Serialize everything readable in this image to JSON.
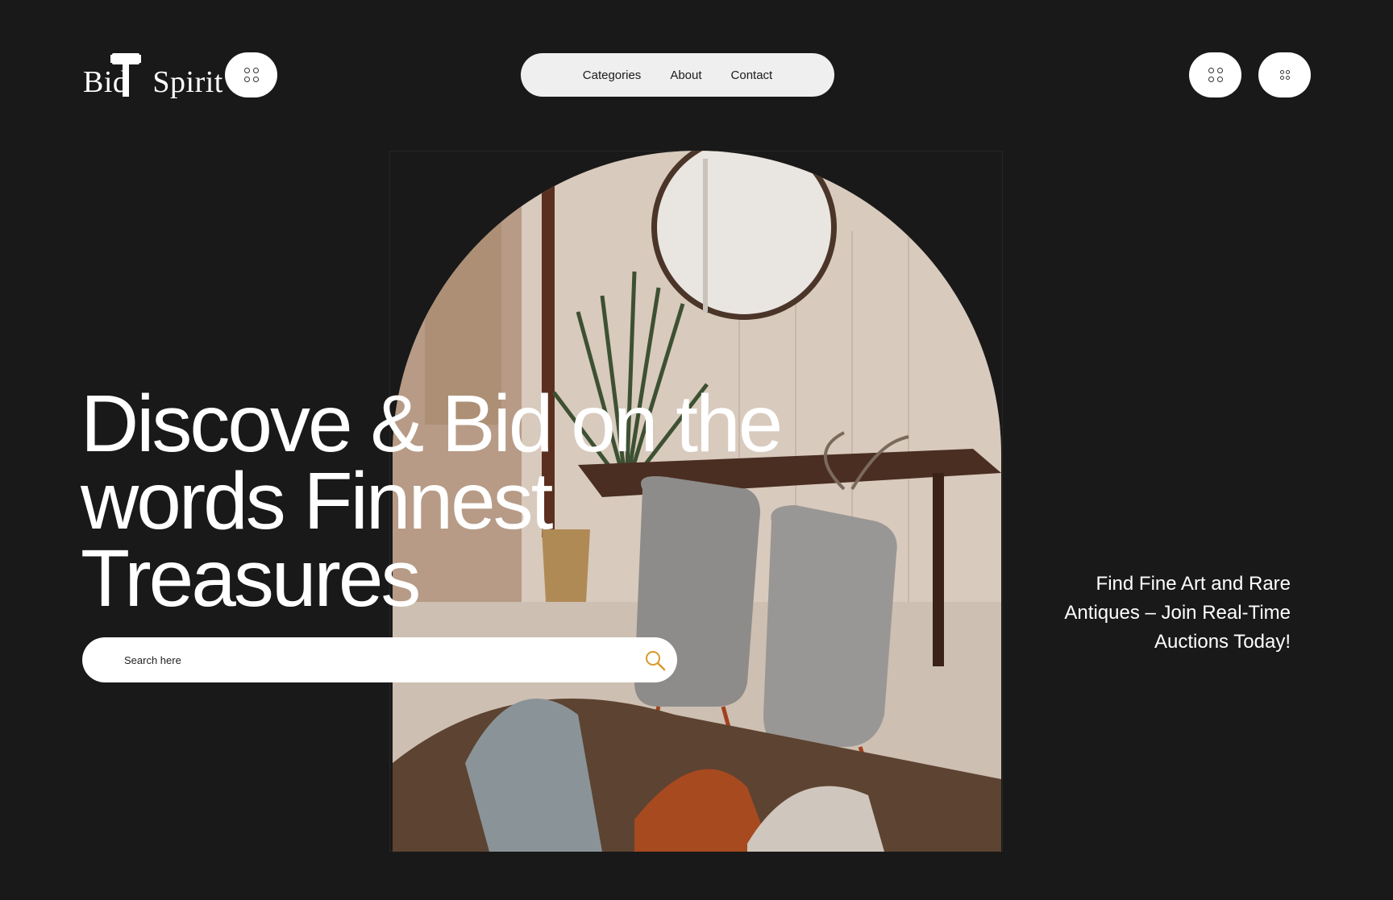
{
  "brand": {
    "logo_word_1": "Bid",
    "logo_word_2": "Spirit"
  },
  "header": {
    "nav": [
      {
        "label": "Categories"
      },
      {
        "label": "About"
      },
      {
        "label": "Contact"
      }
    ],
    "icons": {
      "menu": "grid-dots-icon",
      "apps": "grid-dots-icon",
      "more": "grid-dots-small-icon"
    }
  },
  "hero": {
    "headline_line_1": "Discove & Bid on the",
    "headline_line_2": "words Finnest",
    "headline_line_3": "Treasures",
    "search_placeholder": "Search here",
    "tagline_line_1": "Find Fine Art and Rare",
    "tagline_line_2": "Antiques – Join Real-Time",
    "tagline_line_3": "Auctions Today!",
    "image_subject": "interior-dining-room-photo",
    "search_icon_color": "#d99a2b",
    "background_color": "#191919"
  }
}
